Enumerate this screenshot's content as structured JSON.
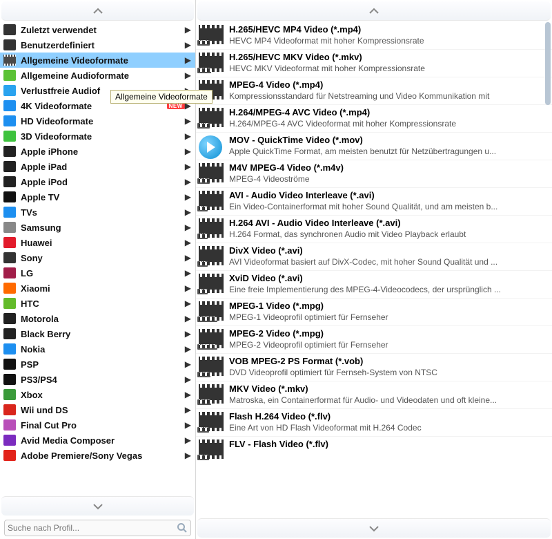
{
  "tooltip": "Allgemeine Videoformate",
  "search": {
    "placeholder": "Suche nach Profil..."
  },
  "categories": [
    {
      "label": "Zuletzt verwendet",
      "icon": "clock-icon",
      "color": "#333",
      "selected": false,
      "new": false
    },
    {
      "label": "Benutzerdefiniert",
      "icon": "gear-icon",
      "color": "#333",
      "selected": false,
      "new": false
    },
    {
      "label": "Allgemeine Videoformate",
      "icon": "film-icon",
      "color": "#4a4a4a",
      "selected": true,
      "new": false
    },
    {
      "label": "Allgemeine Audioformate",
      "icon": "music-icon",
      "color": "#5bc236",
      "selected": false,
      "new": false
    },
    {
      "label": "Verlustfreie Audiof",
      "icon": "note-icon",
      "color": "#2aa3ef",
      "selected": false,
      "new": false
    },
    {
      "label": "4K Videoformate",
      "icon": "4k-icon",
      "color": "#1d8ff0",
      "selected": false,
      "new": true
    },
    {
      "label": "HD Videoformate",
      "icon": "hd-icon",
      "color": "#1d8ff0",
      "selected": false,
      "new": false
    },
    {
      "label": "3D Videoformate",
      "icon": "3d-icon",
      "color": "#3ec23e",
      "selected": false,
      "new": false
    },
    {
      "label": "Apple iPhone",
      "icon": "iphone-icon",
      "color": "#222",
      "selected": false,
      "new": false
    },
    {
      "label": "Apple iPad",
      "icon": "ipad-icon",
      "color": "#222",
      "selected": false,
      "new": false
    },
    {
      "label": "Apple iPod",
      "icon": "ipod-icon",
      "color": "#222",
      "selected": false,
      "new": false
    },
    {
      "label": "Apple TV",
      "icon": "appletv-icon",
      "color": "#111",
      "selected": false,
      "new": false
    },
    {
      "label": "TVs",
      "icon": "tv-icon",
      "color": "#1d8ff0",
      "selected": false,
      "new": false
    },
    {
      "label": "Samsung",
      "icon": "samsung-icon",
      "color": "#888",
      "selected": false,
      "new": false
    },
    {
      "label": "Huawei",
      "icon": "huawei-icon",
      "color": "#e21b2b",
      "selected": false,
      "new": false
    },
    {
      "label": "Sony",
      "icon": "sony-icon",
      "color": "#333",
      "selected": false,
      "new": false
    },
    {
      "label": "LG",
      "icon": "lg-icon",
      "color": "#a11d49",
      "selected": false,
      "new": false
    },
    {
      "label": "Xiaomi",
      "icon": "xiaomi-icon",
      "color": "#ff6a00",
      "selected": false,
      "new": false
    },
    {
      "label": "HTC",
      "icon": "htc-icon",
      "color": "#63bb2a",
      "selected": false,
      "new": false
    },
    {
      "label": "Motorola",
      "icon": "motorola-icon",
      "color": "#222",
      "selected": false,
      "new": false
    },
    {
      "label": "Black Berry",
      "icon": "blackberry-icon",
      "color": "#222",
      "selected": false,
      "new": false
    },
    {
      "label": "Nokia",
      "icon": "nokia-icon",
      "color": "#1d8ff0",
      "selected": false,
      "new": false
    },
    {
      "label": "PSP",
      "icon": "psp-icon",
      "color": "#111",
      "selected": false,
      "new": false
    },
    {
      "label": "PS3/PS4",
      "icon": "ps-icon",
      "color": "#111",
      "selected": false,
      "new": false
    },
    {
      "label": "Xbox",
      "icon": "xbox-icon",
      "color": "#3a9a3a",
      "selected": false,
      "new": false
    },
    {
      "label": "Wii und DS",
      "icon": "wii-icon",
      "color": "#d9261c",
      "selected": false,
      "new": false
    },
    {
      "label": "Final Cut Pro",
      "icon": "fcp-icon",
      "color": "#b94fb9",
      "selected": false,
      "new": false
    },
    {
      "label": "Avid Media Composer",
      "icon": "avid-icon",
      "color": "#7b2bbf",
      "selected": false,
      "new": false
    },
    {
      "label": "Adobe Premiere/Sony Vegas",
      "icon": "adobe-icon",
      "color": "#e2231a",
      "selected": false,
      "new": false
    }
  ],
  "formats": [
    {
      "title": "H.265/HEVC MP4 Video (*.mp4)",
      "desc": "HEVC MP4 Videoformat mit hoher Kompressionsrate",
      "tag": "MP4",
      "kind": "film"
    },
    {
      "title": "H.265/HEVC MKV Video (*.mkv)",
      "desc": "HEVC MKV Videoformat mit hoher Kompressionsrate",
      "tag": "MKV",
      "kind": "film"
    },
    {
      "title": "MPEG-4 Video (*.mp4)",
      "desc": "Kompressionsstandard für Netstreaming und Video Kommunikation mit",
      "tag": "MP4",
      "kind": "film"
    },
    {
      "title": "H.264/MPEG-4 AVC Video (*.mp4)",
      "desc": "H.264/MPEG-4 AVC Videoformat mit hoher Kompressionsrate",
      "tag": "AVC",
      "kind": "film"
    },
    {
      "title": "MOV - QuickTime Video (*.mov)",
      "desc": "Apple QuickTime Format, am meisten benutzt für Netzübertragungen u...",
      "tag": "",
      "kind": "qt"
    },
    {
      "title": "M4V MPEG-4 Video (*.m4v)",
      "desc": "MPEG-4 Videoströme",
      "tag": "M4V",
      "kind": "film"
    },
    {
      "title": "AVI - Audio Video Interleave (*.avi)",
      "desc": "Ein Video-Containerformat mit hoher Sound Qualität, und am meisten b...",
      "tag": "AVI",
      "kind": "film"
    },
    {
      "title": "H.264 AVI - Audio Video Interleave (*.avi)",
      "desc": "H.264 Format, das synchronen Audio mit Video Playback erlaubt",
      "tag": "AVI",
      "kind": "film"
    },
    {
      "title": "DivX Video (*.avi)",
      "desc": "AVI Videoformat basiert auf DivX-Codec, mit hoher Sound Qualität und ...",
      "tag": "AVI",
      "kind": "film"
    },
    {
      "title": "XviD Video (*.avi)",
      "desc": "Eine freie Implementierung des MPEG-4-Videocodecs, der ursprünglich ...",
      "tag": "AVI",
      "kind": "film"
    },
    {
      "title": "MPEG-1 Video (*.mpg)",
      "desc": "MPEG-1 Videoprofil optimiert für Fernseher",
      "tag": "MPEG1",
      "kind": "film"
    },
    {
      "title": "MPEG-2 Video (*.mpg)",
      "desc": "MPEG-2 Videoprofil optimiert für Fernseher",
      "tag": "MPEG2",
      "kind": "film"
    },
    {
      "title": "VOB MPEG-2 PS Format (*.vob)",
      "desc": "DVD Videoprofil optimiert für Fernseh-System von NTSC",
      "tag": "VOB",
      "kind": "film"
    },
    {
      "title": "MKV Video (*.mkv)",
      "desc": "Matroska, ein Containerformat für Audio- und Videodaten und oft kleine...",
      "tag": "MKV",
      "kind": "film"
    },
    {
      "title": "Flash H.264 Video (*.flv)",
      "desc": "Eine Art von HD Flash Videoformat mit H.264 Codec",
      "tag": "FLV",
      "kind": "film"
    },
    {
      "title": "FLV - Flash Video (*.flv)",
      "desc": "",
      "tag": "FLV",
      "kind": "film"
    }
  ],
  "newBadge": "NEW"
}
